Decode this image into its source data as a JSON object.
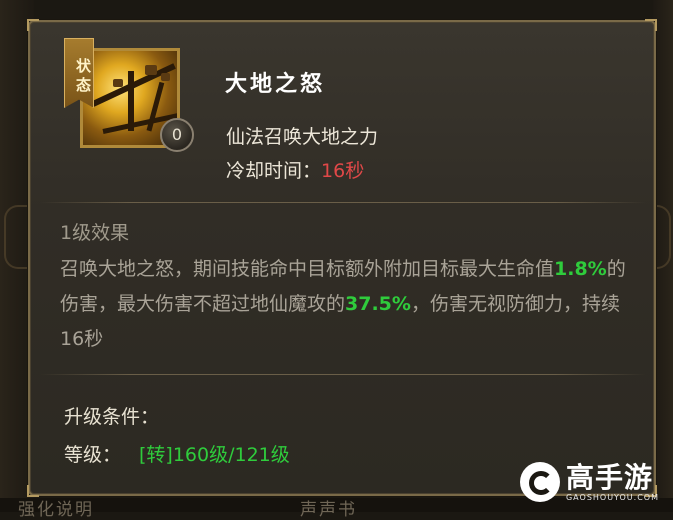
{
  "tooltip": {
    "state_tag": "状态",
    "skill_level_badge": "0",
    "skill_name": "大地之怒",
    "skill_desc": "仙法召唤大地之力",
    "cooldown_label": "冷却时间：",
    "cooldown_value": "16秒",
    "effect_title": "1级效果",
    "effect_part1": "召唤大地之怒，期间技能命中目标额外附加目标最大生命值",
    "effect_pct1": "1.8%",
    "effect_part2": "的伤害，最大伤害不超过地仙魔攻的",
    "effect_pct2": "37.5%",
    "effect_part3": "，伤害无视防御力，持续16秒",
    "upgrade_title": "升级条件：",
    "upgrade_level_label": "等级：",
    "upgrade_level_value": "[转]160级/121级"
  },
  "background": {
    "bottom_text_left": "强化说明",
    "bottom_text_right": "声声书"
  },
  "watermark": {
    "brand": "高手游",
    "domain": "GAOSHOUYOU.COM"
  },
  "colors": {
    "highlight_green": "#2fcc3c",
    "cooldown_red": "#e04848",
    "frame_gold": "#7a6a48"
  }
}
